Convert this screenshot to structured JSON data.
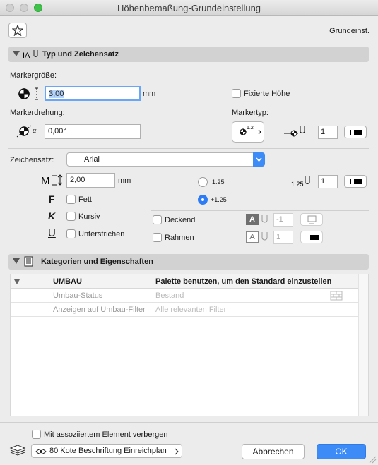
{
  "window": {
    "title": "Höhenbemaßung-Grundeinstellung"
  },
  "top": {
    "preset_label": "Grundeinst."
  },
  "section1": {
    "title": "Typ und Zeichensatz"
  },
  "marker": {
    "size_label": "Markergröße:",
    "size_value": "3,00",
    "size_unit": "mm",
    "fixed_height_label": "Fixierte Höhe",
    "rotation_label": "Markerdrehung:",
    "rotation_value": "0,00°",
    "type_label": "Markertyp:",
    "type_symbol": "1.2",
    "pen_value": "1"
  },
  "font": {
    "label": "Zeichensatz:",
    "value": "Arial",
    "size_value": "2,00",
    "size_unit": "mm",
    "bold_label": "Fett",
    "italic_label": "Kursiv",
    "underline_label": "Unterstrichen",
    "bold_glyph": "F",
    "italic_glyph": "K",
    "underline_glyph": "U"
  },
  "format": {
    "option1": "1.25",
    "option2": "+1.25",
    "sample_label": "1.25",
    "pen_value": "1",
    "opaque_label": "Deckend",
    "opaque_value": "-1",
    "frame_label": "Rahmen",
    "frame_value": "1"
  },
  "section2": {
    "title": "Kategorien und Eigenschaften"
  },
  "props": {
    "header_key": "UMBAU",
    "header_value": "Palette benutzen, um den Standard einzustellen",
    "rows": [
      {
        "key": "Umbau-Status",
        "value": "Bestand"
      },
      {
        "key": "Anzeigen auf Umbau-Filter",
        "value": "Alle relevanten Filter"
      }
    ]
  },
  "footer": {
    "hide_label": "Mit assoziiertem Element verbergen",
    "layer_label": "80 Kote Beschriftung Einreichplan",
    "cancel_label": "Abbrechen",
    "ok_label": "OK"
  },
  "colors": {
    "accent": "#2d7cf6",
    "ok_button": "#3d8bf7"
  }
}
